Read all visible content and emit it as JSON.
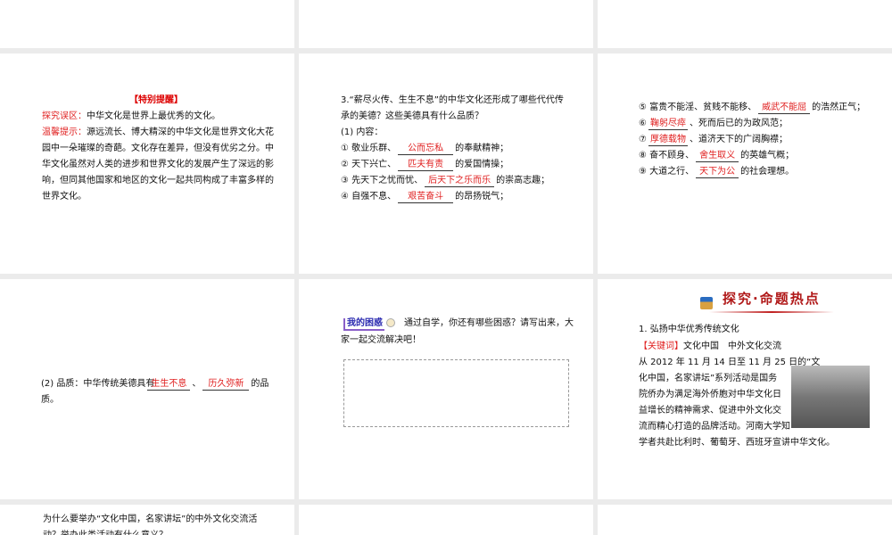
{
  "slides": {
    "reminder": {
      "title": "【特别提醒】",
      "misc_label": "探究误区：",
      "misc_text": "中华文化是世界上最优秀的文化。",
      "tip_label": "温馨提示：",
      "tip_lines": [
        "源远流长、博大精深的中华文化是世界文化大花",
        "园中一朵璀璨的奇葩。文化存在差异，但没有优劣之分。中",
        "华文化虽然对人类的进步和世界文化的发展产生了深远的影",
        "响，但同其他国家和地区的文化一起共同构成了丰富多样的",
        "世界文化。"
      ]
    },
    "virtues1": {
      "question": [
        "3.“薪尽火传、生生不息”的中华文化还形成了哪些代代传",
        "承的美德？这些美德具有什么品质？"
      ],
      "content_label": "(1) 内容：",
      "items": [
        {
          "pre": "① 敬业乐群、",
          "answer": "公而忘私",
          "post": "的奉献精神；"
        },
        {
          "pre": "② 天下兴亡、",
          "answer": "匹夫有责",
          "post": "的爱国情操；"
        },
        {
          "pre": "③ 先天下之忧而忧、",
          "answer": "后天下之乐而乐",
          "post": "的崇高志趣；"
        },
        {
          "pre": "④ 自强不息、",
          "answer": "艰苦奋斗",
          "post": "的昂扬锐气；"
        }
      ]
    },
    "virtues2": {
      "items": [
        {
          "pre": "⑤ 富贵不能淫、贫贱不能移、",
          "answer": "威武不能屈",
          "post": "的浩然正气；"
        },
        {
          "pre": "⑥",
          "answer": "鞠躬尽瘁",
          "post": "、死而后已的为政风范；"
        },
        {
          "pre": "⑦",
          "answer": "厚德载物",
          "post": "、道济天下的广阔胸襟；"
        },
        {
          "pre": "⑧ 奋不顾身、",
          "answer": "舍生取义",
          "post": "的英雄气概；"
        },
        {
          "pre": "⑨ 大道之行、",
          "answer": "天下为公",
          "post": "的社会理想。"
        }
      ]
    },
    "quality": {
      "pre": "(2) 品质：中华传统美德具有",
      "answer1": "生生不息",
      "sep": "、",
      "answer2": "历久弥新",
      "post": "的品",
      "line2": "质。"
    },
    "confusion": {
      "badge": "我的困惑",
      "line1": "通过自学，你还有哪些困惑？请写出来，大",
      "line2": "家一起交流解决吧！"
    },
    "hotspot": {
      "header": "探究·命题热点",
      "heading": "1. 弘扬中华优秀传统文化",
      "keyword_label": "【关键词】",
      "keyword_text": "文化中国　中外文化交流",
      "lines": [
        "从 2012 年 11 月 14 日至 11 月 25 日的“文",
        "化中国，名家讲坛”系列活动是国务",
        "院侨办为满足海外侨胞对中华文化日",
        "益增长的精神需求、促进中外文化交",
        "流而精心打造的品牌活动。河南大学知",
        "学者共赴比利时、葡萄牙、西班牙宣讲中华文化。"
      ]
    },
    "question": {
      "lines": [
        "为什么要举办“文化中国，名家讲坛”的中外文化交流活",
        "动？举办此类活动有什么意义？"
      ]
    }
  }
}
